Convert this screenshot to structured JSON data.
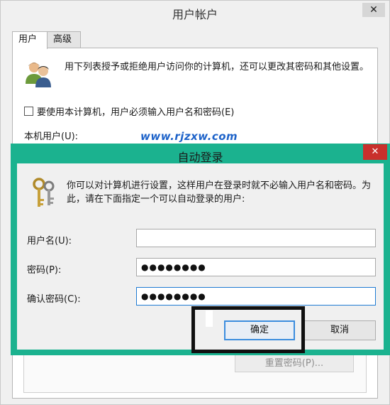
{
  "background_window": {
    "title": "用户帐户",
    "close_glyph": "✕",
    "tabs": [
      {
        "label": "用户"
      },
      {
        "label": "高级"
      }
    ],
    "intro_text": "用下列表授予或拒绝用户访问你的计算机，还可以更改其密码和其他设置。",
    "require_login_checkbox": {
      "label": "要使用本计算机，用户必须输入用户名和密码(E)",
      "checked": false
    },
    "local_users_label": "本机用户(U):",
    "watermark": "www.rjzxw.com",
    "reset_password_button": "重置密码(P)..."
  },
  "dialog": {
    "title": "自动登录",
    "close_glyph": "✕",
    "description": "你可以对计算机进行设置，这样用户在登录时就不必输入用户名和密码。为此，请在下面指定一个可以自动登录的用户:",
    "fields": {
      "username": {
        "label": "用户名(U):",
        "value": ""
      },
      "password": {
        "label": "密码(P):",
        "value": "●●●●●●●●"
      },
      "confirm": {
        "label": "确认密码(C):",
        "value": "●●●●●●●●"
      }
    },
    "ok_button": "确定",
    "cancel_button": "取消"
  },
  "colors": {
    "dialog_frame": "#1bb28f",
    "close_button": "#c9302c",
    "focus_border": "#1f7bd3",
    "watermark": "#1e63c9"
  }
}
